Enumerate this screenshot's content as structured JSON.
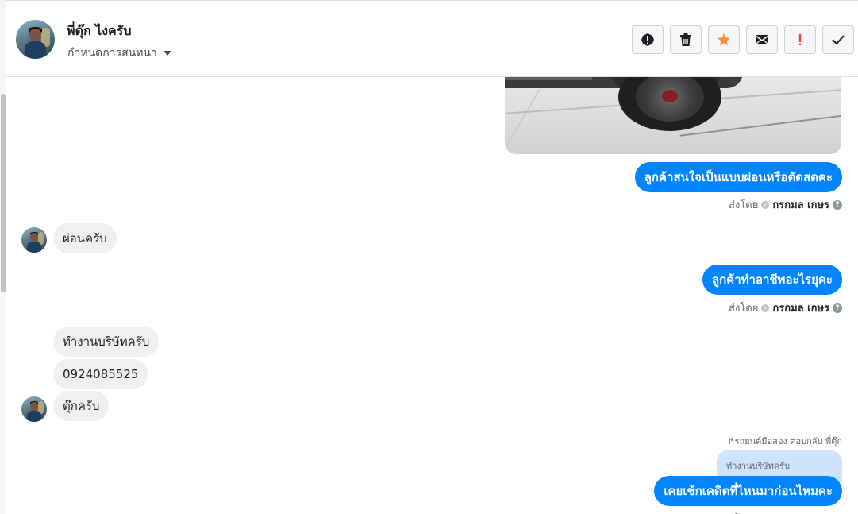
{
  "header": {
    "contact_name": "พี่ตุ๊ก ไงครับ",
    "assign_label": "กำหนดการสนทนา",
    "toolbar": [
      {
        "name": "spam-button",
        "icon": "alert-circle-icon"
      },
      {
        "name": "delete-button",
        "icon": "trash-icon"
      },
      {
        "name": "star-button",
        "icon": "star-icon"
      },
      {
        "name": "mark-unread-button",
        "icon": "envelope-icon"
      },
      {
        "name": "important-button",
        "icon": "exclamation-icon"
      },
      {
        "name": "done-button",
        "icon": "check-icon"
      }
    ]
  },
  "colors": {
    "outgoing_bubble": "#0084ff",
    "incoming_bubble": "#f1f0f0",
    "quoted_bubble": "#cde4fd",
    "star": "#f7923b",
    "important": "#fa383e"
  },
  "messages": {
    "out_1": "ลูกค้าสนใจเป็นแบบผ่อนหรือตัดสดคะ",
    "in_1": "ผ่อนครับ",
    "out_2": "ลูกค้าทำอาชีพอะไรยุคะ",
    "in_2": "ทำงานบริษัทครับ",
    "in_3": "0924085525",
    "in_4": "ตุ๊กครับ",
    "reply_note": "↱รถยนต์มือสอง ตอบกลับ พี่ตุ๊ก",
    "quoted": "ทำงานบริษัทครับ",
    "out_3": "เคยเช้กเคดิตที่ไหนมาก่อนไหมคะ"
  },
  "sent_by": {
    "prefix": "ส่งโดย",
    "name": "กรกมล เกษร",
    "help": "?"
  }
}
